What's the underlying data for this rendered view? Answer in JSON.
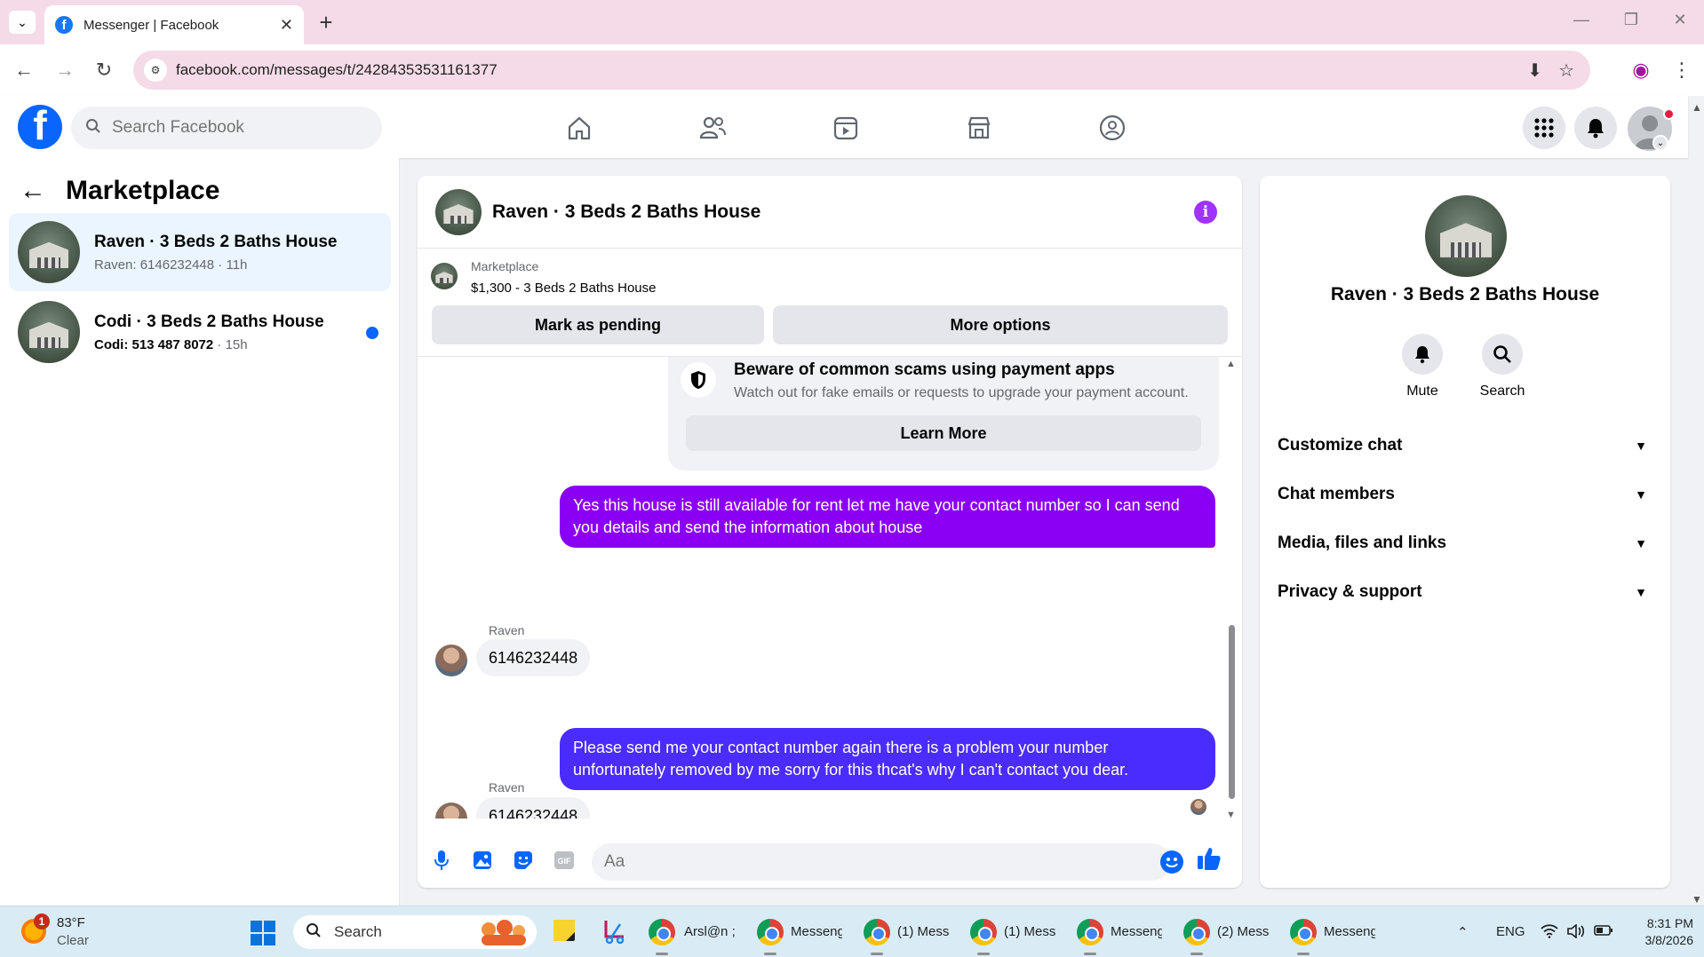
{
  "browser": {
    "tab_title": "Messenger | Facebook",
    "url": "facebook.com/messages/t/24284353531161377"
  },
  "header": {
    "search_placeholder": "Search Facebook"
  },
  "sidebar": {
    "title": "Marketplace",
    "conversations": [
      {
        "name": "Raven · 3 Beds 2 Baths House",
        "preview": "Raven: 6146232448",
        "time": "11h",
        "active": true,
        "unread": false
      },
      {
        "name": "Codi · 3 Beds 2 Baths House",
        "preview": "Codi: 513 487 8072",
        "time": "15h",
        "active": false,
        "unread": true
      }
    ]
  },
  "chat": {
    "title": "Raven · 3 Beds 2 Baths House",
    "listing": {
      "source": "Marketplace",
      "price_title": "$1,300 - 3 Beds 2 Baths House",
      "mark_pending_label": "Mark as pending",
      "more_options_label": "More options"
    },
    "scam_notice": {
      "title": "Beware of common scams using payment apps",
      "description": "Watch out for fake emails or requests to upgrade your payment account.",
      "button_label": "Learn More"
    },
    "messages": [
      {
        "from": "me",
        "text": "Yes this house is still available for rent let me have your contact number so I can send you details and send the information about house"
      },
      {
        "from": "Raven",
        "sender_label": "Raven",
        "text": "6146232448"
      },
      {
        "from": "me",
        "text": "Please send me your contact number again there is a problem your number unfortunately removed by me sorry for this thcat's why I can't contact you dear."
      },
      {
        "from": "Raven",
        "sender_label": "Raven",
        "text": "6146232448"
      }
    ],
    "composer_placeholder": "Aa"
  },
  "details": {
    "name": "Raven · 3 Beds 2 Baths House",
    "actions": [
      {
        "label": "Mute",
        "icon": "bell-icon"
      },
      {
        "label": "Search",
        "icon": "search-icon"
      }
    ],
    "sections": [
      "Customize chat",
      "Chat members",
      "Media, files and links",
      "Privacy & support"
    ]
  },
  "taskbar": {
    "weather_temp": "83°F",
    "weather_cond": "Clear",
    "weather_badge": "1",
    "search_label": "Search",
    "apps": [
      {
        "label": "Arsl@n ;"
      },
      {
        "label": "Messeng"
      },
      {
        "label": "(1) Mess"
      },
      {
        "label": "(1) Mess"
      },
      {
        "label": "Messeng"
      },
      {
        "label": "(2) Mess"
      },
      {
        "label": "Messeng"
      }
    ],
    "language": "ENG",
    "time": "8:31 PM",
    "date": "3/8/2026"
  },
  "colors": {
    "accent": "#0866ff",
    "bubble_purple": "#8a00f5",
    "bubble_blue": "#4a2cff",
    "tabbar_bg": "#f5dbe7"
  }
}
